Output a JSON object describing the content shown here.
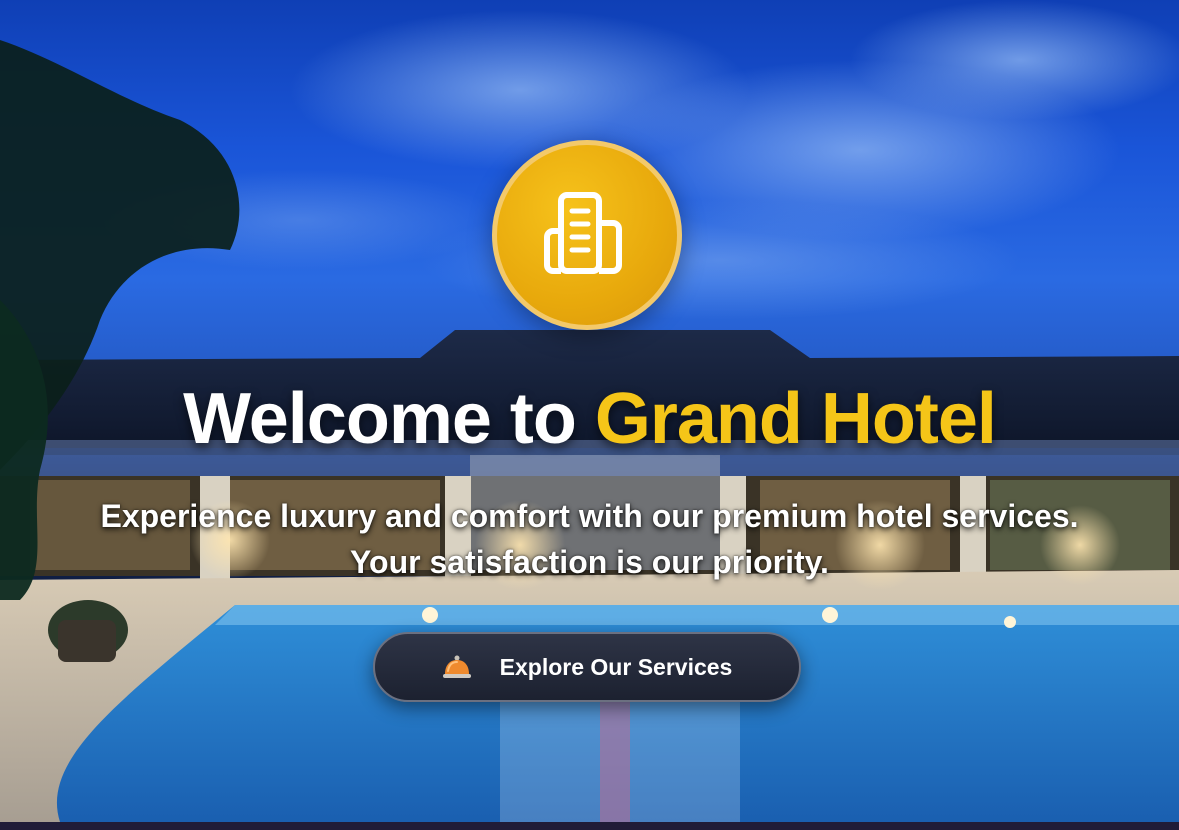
{
  "hero": {
    "title_prefix": "Welcome to",
    "title_accent": "Grand Hotel",
    "subtitle_line1": "Experience luxury and comfort with our premium hotel services.",
    "subtitle_line2": "Your satisfaction is our priority."
  },
  "logo": {
    "icon": "hotel-building-icon"
  },
  "cta": {
    "label": "Explore Our Services",
    "icon": "service-bell-icon"
  },
  "colors": {
    "accent": "#f5c518",
    "badge": "#e8a90c",
    "button": "#252a3a",
    "text": "#ffffff"
  }
}
